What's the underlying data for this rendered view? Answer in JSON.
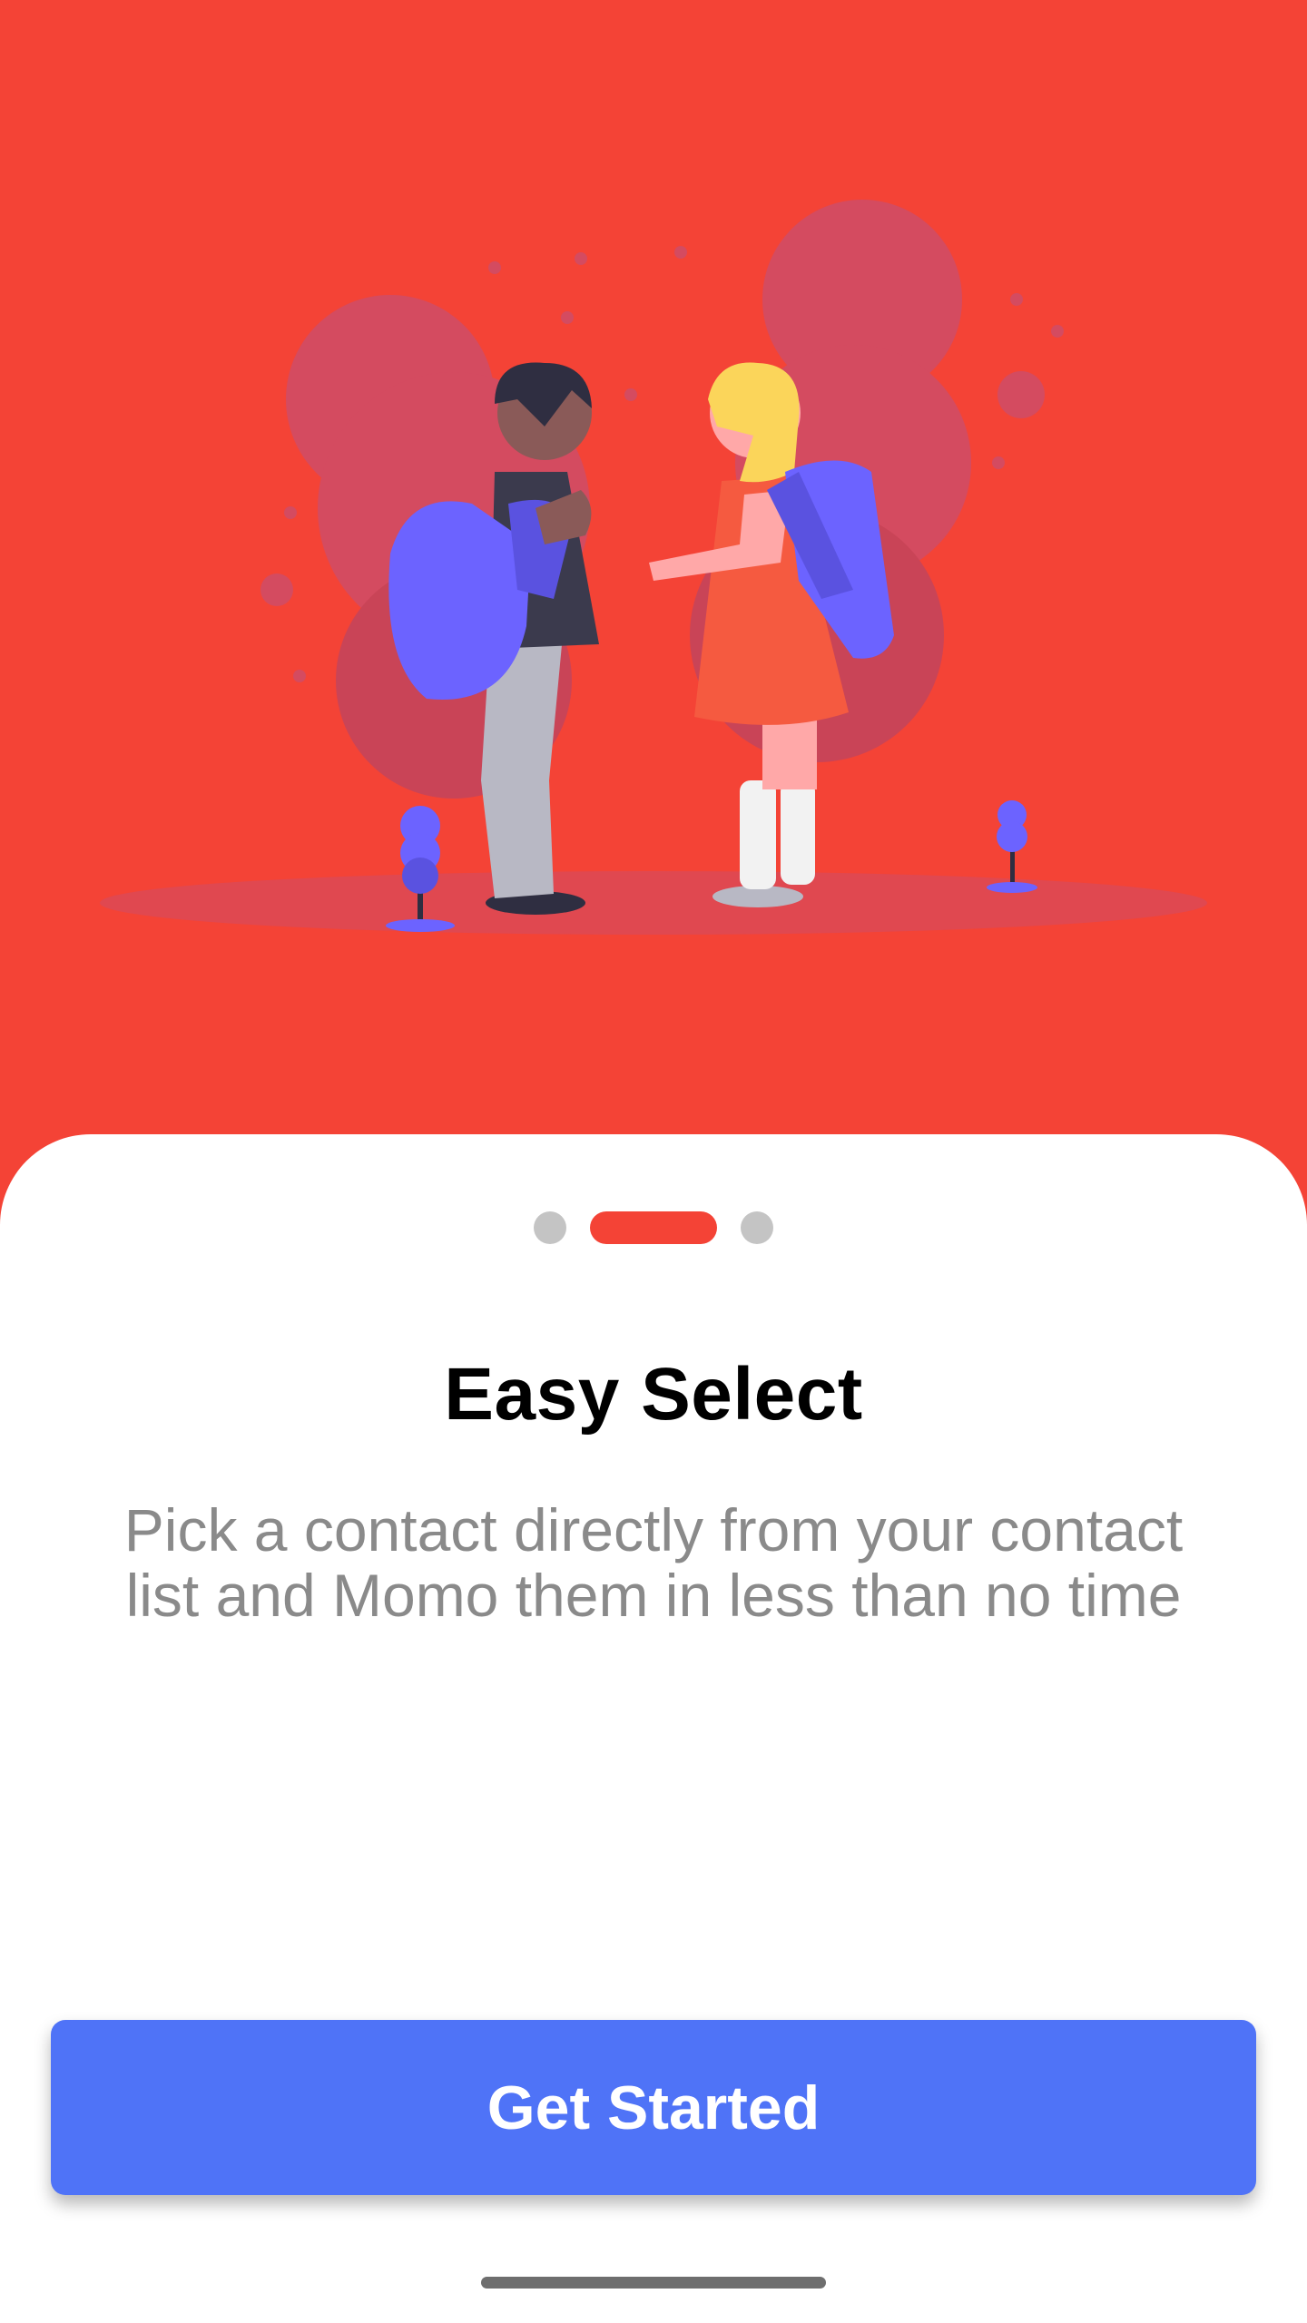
{
  "onboarding": {
    "title": "Easy Select",
    "description": "Pick a contact directly from your contact list and Momo them in less than no time",
    "page_indicator": {
      "total": 3,
      "current": 2
    },
    "cta_label": "Get Started"
  },
  "colors": {
    "hero_background": "#f44336",
    "active_dot": "#f44336",
    "inactive_dot": "#c4c4c4",
    "cta_background": "#4f73f7",
    "cta_text": "#ffffff",
    "title_text": "#000000",
    "description_text": "#8a8a8a"
  },
  "icons": {
    "illustration": "kids-with-backpacks-illustration"
  }
}
